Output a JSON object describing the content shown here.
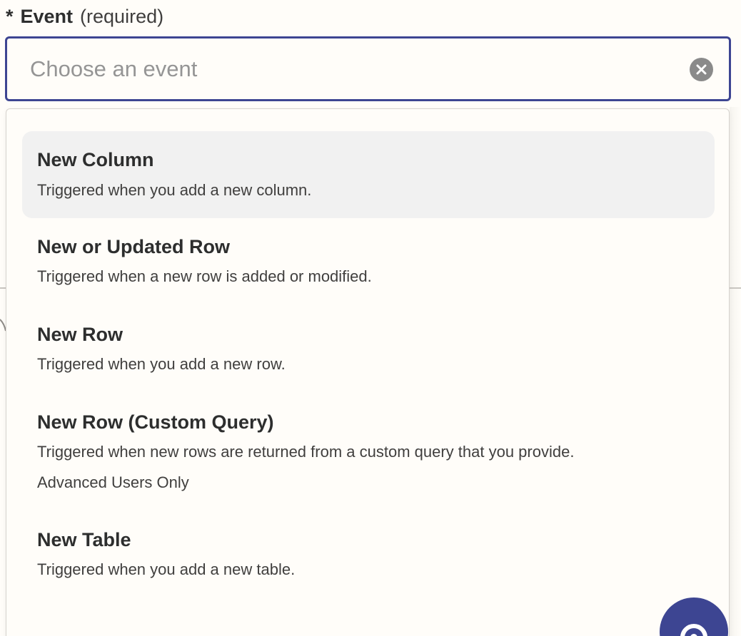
{
  "field": {
    "asterisk": "*",
    "label": "Event",
    "required_text": "(required)",
    "placeholder": "Choose an event",
    "value": ""
  },
  "options": [
    {
      "title": "New Column",
      "description": "Triggered when you add a new column.",
      "note": ""
    },
    {
      "title": "New or Updated Row",
      "description": "Triggered when a new row is added or modified.",
      "note": ""
    },
    {
      "title": "New Row",
      "description": "Triggered when you add a new row.",
      "note": ""
    },
    {
      "title": "New Row (Custom Query)",
      "description": "Triggered when new rows are returned from a custom query that you provide.",
      "note": "Advanced Users Only"
    },
    {
      "title": "New Table",
      "description": "Triggered when you add a new table.",
      "note": ""
    }
  ],
  "colors": {
    "accent": "#3d4592",
    "background": "#fffdf9",
    "highlight": "#f1f1f1",
    "clear_icon": "#8a8a8a"
  },
  "icons": {
    "clear": "close-circle-icon",
    "help": "help-chat-icon"
  }
}
